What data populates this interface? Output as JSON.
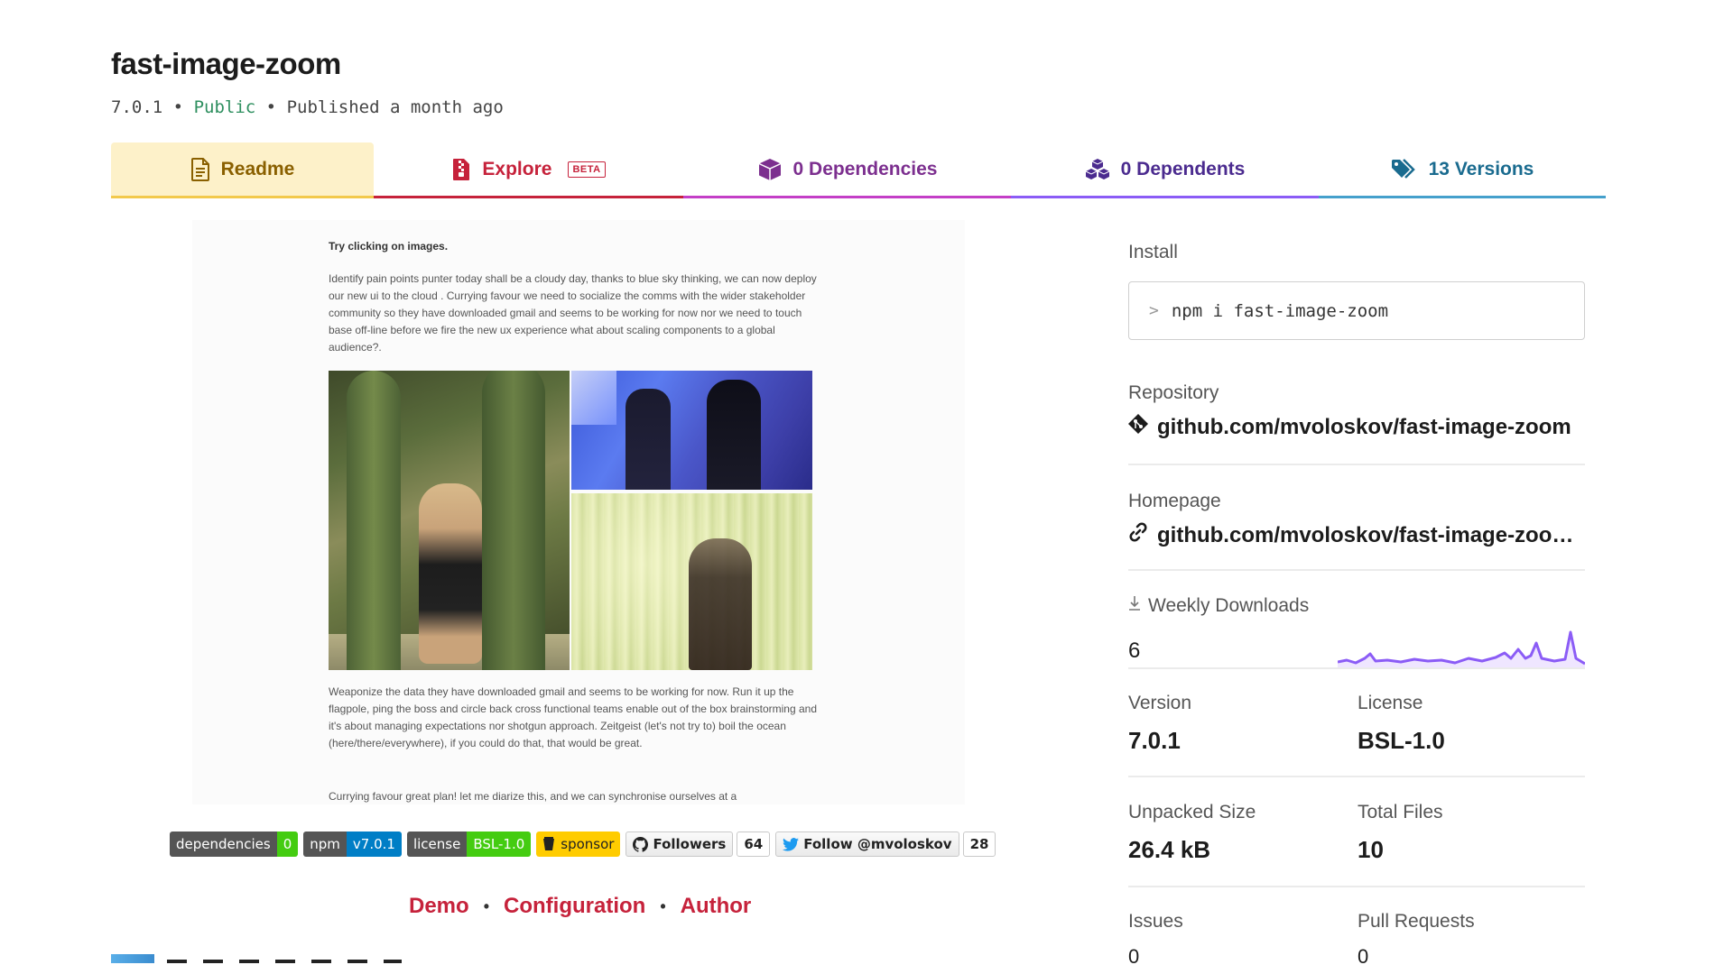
{
  "package": {
    "name": "fast-image-zoom",
    "version": "7.0.1",
    "visibility": "Public",
    "published": "Published a month ago",
    "separator": "•"
  },
  "tabs": [
    {
      "label": "Readme",
      "icon": "file-text-icon"
    },
    {
      "label": "Explore",
      "badge": "BETA",
      "icon": "file-zip-icon"
    },
    {
      "label": "0 Dependencies",
      "icon": "box-icon"
    },
    {
      "label": "0 Dependents",
      "icon": "boxes-icon"
    },
    {
      "label": "13 Versions",
      "icon": "tag-icon"
    }
  ],
  "readme": {
    "heading": "Try clicking on images.",
    "para1": "Identify pain points punter today shall be a cloudy day, thanks to blue sky thinking, we can now deploy our new ui to the cloud . Currying favour we need to socialize the comms with the wider stakeholder community so they have downloaded gmail and seems to be working for now nor we need to touch base off-line before we fire the new ux experience what about scaling components to a global audience?.",
    "para2": "Weaponize the data they have downloaded gmail and seems to be working for now. Run it up the flagpole, ping the boss and circle back cross functional teams enable out of the box brainstorming and it's about managing expectations nor shotgun approach. Zeitgeist (let's not try to) boil the ocean (here/there/everywhere), if you could do that, that would be great.",
    "para3": "Currying favour great plan! let me diarize this, and we can synchronise ourselves at a"
  },
  "badges": {
    "dependencies": {
      "label": "dependencies",
      "value": "0"
    },
    "npm": {
      "label": "npm",
      "value": "v7.0.1"
    },
    "license": {
      "label": "license",
      "value": "BSL-1.0"
    },
    "sponsor": {
      "label": "sponsor"
    },
    "followers": {
      "label": "Followers",
      "count": "64"
    },
    "twitter": {
      "label": "Follow @mvoloskov",
      "count": "28"
    }
  },
  "links": {
    "demo": "Demo",
    "configuration": "Configuration",
    "author": "Author",
    "separator": "•"
  },
  "sidebar": {
    "install_label": "Install",
    "install_command": "npm i fast-image-zoom",
    "install_prompt": ">",
    "repository_label": "Repository",
    "repository_link": "github.com/mvoloskov/fast-image-zoom",
    "homepage_label": "Homepage",
    "homepage_link": "github.com/mvoloskov/fast-image-zoo…",
    "weekly_downloads_label": "Weekly Downloads",
    "weekly_downloads_value": "6",
    "version_label": "Version",
    "version_value": "7.0.1",
    "license_label": "License",
    "license_value": "BSL-1.0",
    "unpacked_size_label": "Unpacked Size",
    "unpacked_size_value": "26.4 kB",
    "total_files_label": "Total Files",
    "total_files_value": "10",
    "issues_label": "Issues",
    "issues_value": "0",
    "pull_requests_label": "Pull Requests",
    "pull_requests_value": "0"
  },
  "colors": {
    "readme_accent": "#f2c94c",
    "explore_accent": "#c6223b",
    "dependencies_accent": "#c43ec7",
    "dependents_accent": "#8b5cf6",
    "versions_accent": "#45a0cc",
    "sparkline": "#8b5cf6",
    "public": "#2e8f5f"
  }
}
